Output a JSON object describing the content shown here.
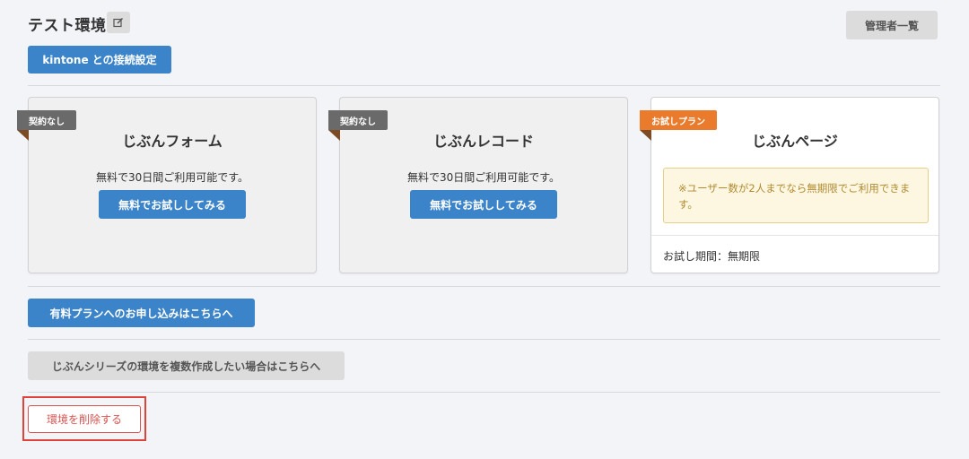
{
  "header": {
    "title": "テスト環境",
    "admin_label": "管理者一覧",
    "kintone_label": "kintone との接続設定"
  },
  "cards": [
    {
      "badge": "契約なし",
      "name": "じぶんフォーム",
      "description": "無料で30日間ご利用可能です。",
      "button": "無料でお試ししてみる"
    },
    {
      "badge": "契約なし",
      "name": "じぶんレコード",
      "description": "無料で30日間ご利用可能です。",
      "button": "無料でお試ししてみる"
    },
    {
      "badge": "お試しプラン",
      "name": "じぶんページ",
      "notice": "※ユーザー数が2人までなら無期限でご利用できます。",
      "period": "お試し期間：無期限"
    }
  ],
  "actions": {
    "paid_plan": "有料プランへのお申し込みはこちらへ",
    "multi_env": "じぶんシリーズの環境を複数作成したい場合はこちらへ",
    "delete_env": "環境を削除する"
  },
  "colors": {
    "primary": "#3c84c9",
    "badge_gray": "#6a6a6a",
    "badge_orange": "#ea7a2c",
    "danger": "#d9534f",
    "highlight_frame": "#e0433a"
  }
}
